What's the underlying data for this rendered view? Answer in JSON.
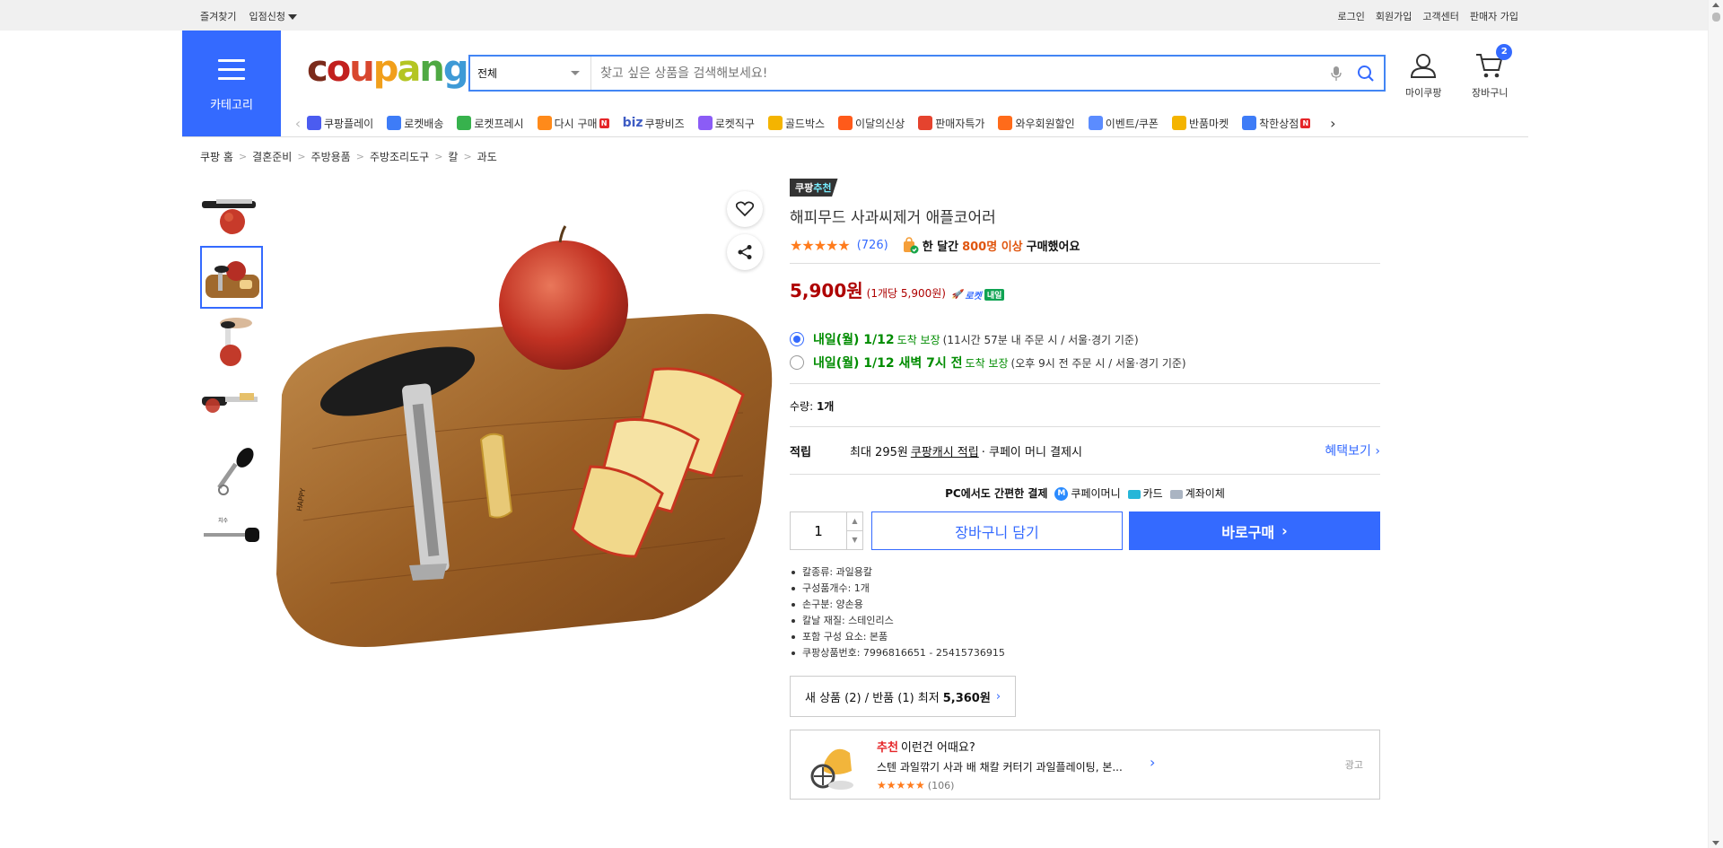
{
  "topbar": {
    "favorites": "즐겨찾기",
    "seller_apply": "입점신청",
    "login": "로그인",
    "signup": "회원가입",
    "customer_center": "고객센터",
    "seller_signup": "판매자 가입"
  },
  "header": {
    "category_label": "카테고리",
    "logo_letters": [
      {
        "ch": "c",
        "color": "#7b2b1b"
      },
      {
        "ch": "o",
        "color": "#c2201e"
      },
      {
        "ch": "u",
        "color": "#d8472e"
      },
      {
        "ch": "p",
        "color": "#f19f1b"
      },
      {
        "ch": "a",
        "color": "#b4c523"
      },
      {
        "ch": "n",
        "color": "#4fa943"
      },
      {
        "ch": "g",
        "color": "#3e9ad6"
      }
    ],
    "search_scope": "전체",
    "search_placeholder": "찾고 싶은 상품을 검색해보세요!",
    "mycoupang": "마이쿠팡",
    "cart": "장바구니",
    "cart_count": "2"
  },
  "nav": [
    {
      "label": "쿠팡플레이",
      "color": "#4b5cf0",
      "badge": ""
    },
    {
      "label": "로켓배송",
      "color": "#3e7cf7",
      "badge": ""
    },
    {
      "label": "로켓프레시",
      "color": "#37b24d",
      "badge": ""
    },
    {
      "label": "다시 구매",
      "color": "#ff8a1a",
      "badge": "N"
    },
    {
      "label": "쿠팡비즈",
      "color": "#ffffff",
      "badge": "",
      "prefix": "biz"
    },
    {
      "label": "로켓직구",
      "color": "#8b5cf6",
      "badge": ""
    },
    {
      "label": "골드박스",
      "color": "#f4b400",
      "badge": ""
    },
    {
      "label": "이달의신상",
      "color": "#ff5a1a",
      "badge": ""
    },
    {
      "label": "판매자특가",
      "color": "#e5432e",
      "badge": ""
    },
    {
      "label": "와우회원할인",
      "color": "#ff6b1a",
      "badge": ""
    },
    {
      "label": "이벤트/쿠폰",
      "color": "#5b8cff",
      "badge": ""
    },
    {
      "label": "반품마켓",
      "color": "#f4b400",
      "badge": ""
    },
    {
      "label": "착한상점",
      "color": "#3e7cf7",
      "badge": "N"
    }
  ],
  "breadcrumb": [
    "쿠팡 홈",
    "결혼준비",
    "주방용품",
    "주방조리도구",
    "칼",
    "과도"
  ],
  "product": {
    "tag_a": "쿠팡",
    "tag_b": "추천",
    "title": "해피무드 사과씨제거 애플코어러",
    "stars": "★★★★★",
    "review_count": "(726)",
    "bought_prefix": "한 달간",
    "bought_count": "800명 이상",
    "bought_suffix": "구매했어요",
    "price": "5,900원",
    "unit_price": "(1개당 5,900원)",
    "rocket_label": "로켓",
    "rocket_day": "내일",
    "ship1_main": "내일(월) 1/12",
    "ship1_small": "도착 보장",
    "ship1_note": "(11시간 57분 내 주문 시 / 서울·경기 기준)",
    "ship2_main": "내일(월) 1/12 새벽 7시 전",
    "ship2_small": "도착 보장",
    "ship2_note": "(오후 9시 전 주문 시 / 서울·경기 기준)",
    "qty_label": "수량:",
    "qty_value": "1개",
    "points_head": "적립",
    "points_pre": "최대 295원",
    "points_link": "쿠팡캐시 적립",
    "points_post": "· 쿠페이 머니 결제시",
    "benefit": "혜택보기",
    "pay_title": "PC에서도 간편한 결제",
    "pay_money": "쿠페이머니",
    "pay_card": "카드",
    "pay_bank": "계좌이체",
    "qty_input": "1",
    "cart_btn": "장바구니 담기",
    "buy_btn": "바로구매",
    "attrs": [
      "칼종류: 과일용칼",
      "구성품개수: 1개",
      "손구분: 양손용",
      "칼날 재질: 스테인리스",
      "포함 구성 요소: 본품",
      "쿠팡상품번호: 7996816651 - 25415736915"
    ],
    "other_sellers": "새 상품 (2) / 반품 (1) 최저",
    "other_price": "5,360원"
  },
  "ad": {
    "rec": "추천",
    "head": "이런건 어때요?",
    "title": "스텐 과일깎기 사과 배 채칼 커터기 과일플레이팅, 본...",
    "stars": "★★★★★",
    "count": "(106)",
    "label": "광고"
  }
}
